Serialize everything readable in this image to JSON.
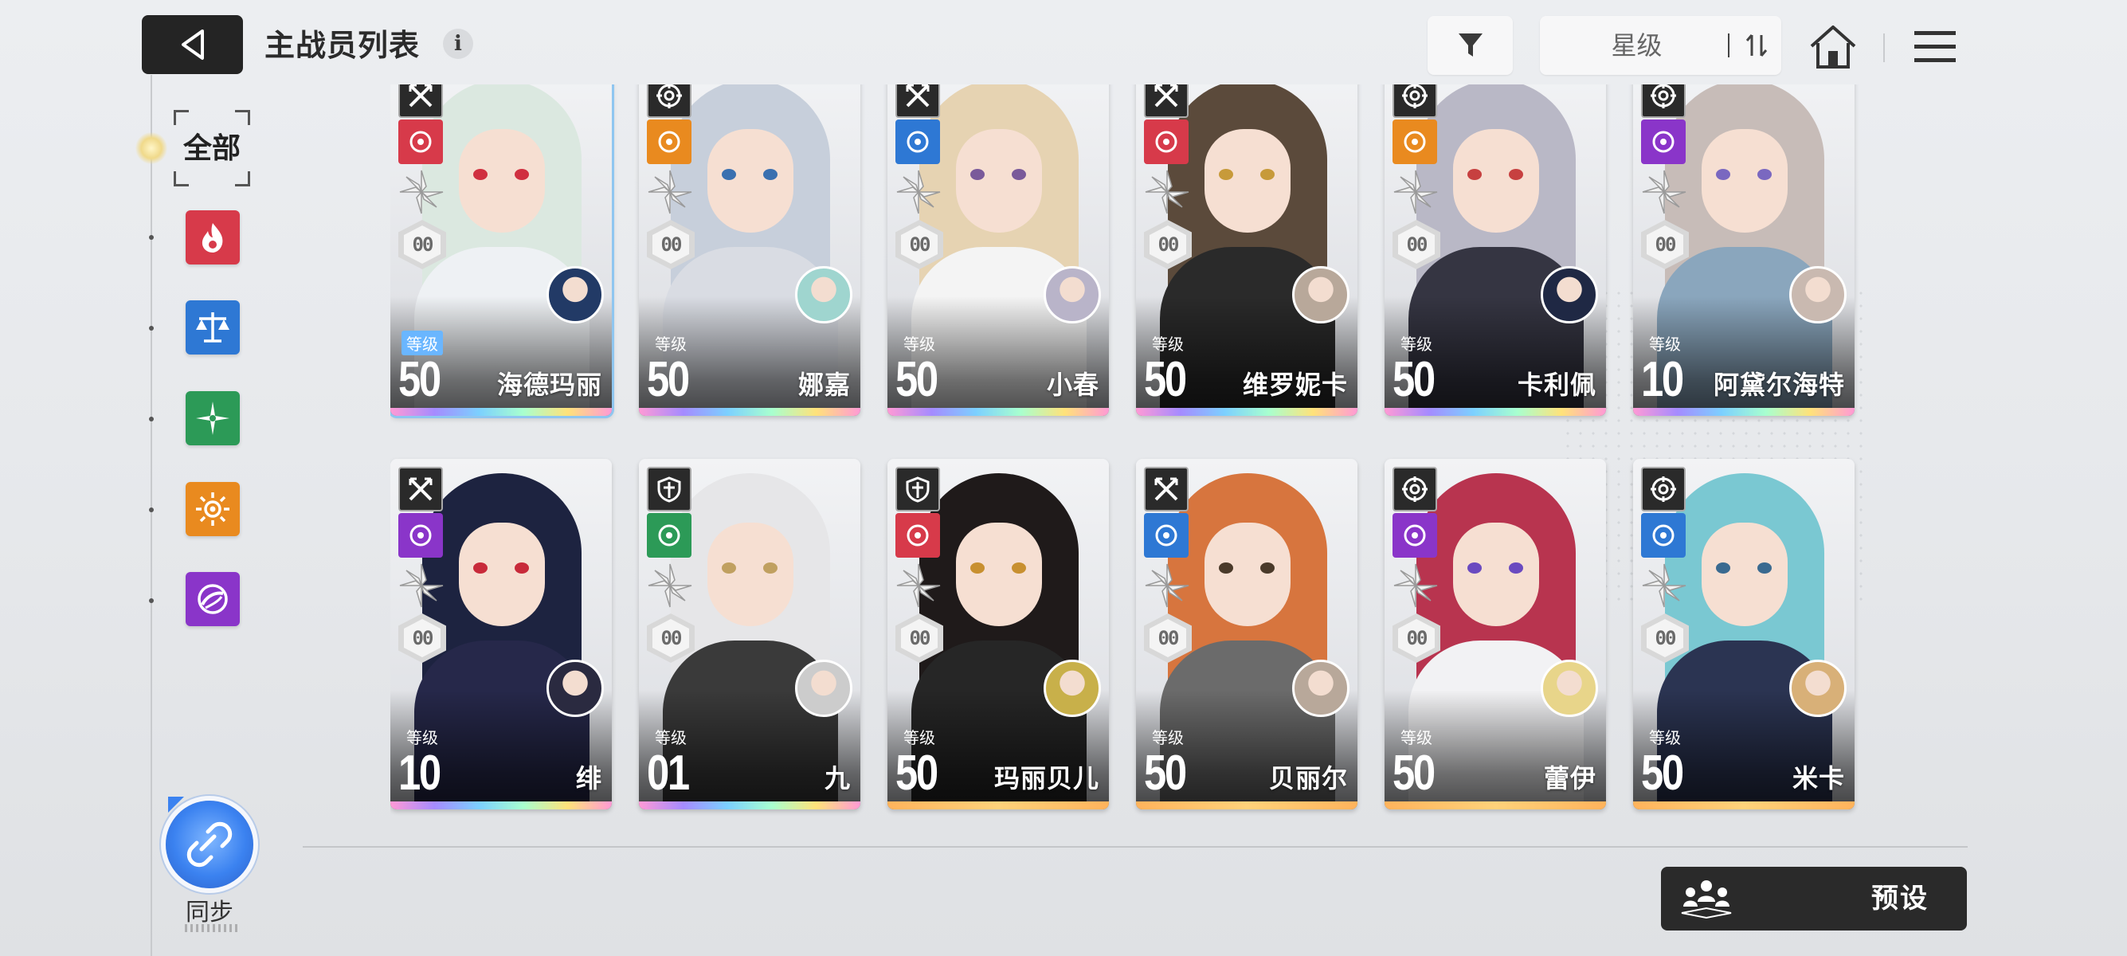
{
  "header": {
    "title": "主战员列表",
    "info_label": "i",
    "sort_label": "星级"
  },
  "sidebar": {
    "all_label": "全部",
    "categories": [
      {
        "name": "burn",
        "color": "#d73a4a"
      },
      {
        "name": "balance",
        "color": "#2e78d4"
      },
      {
        "name": "wind",
        "color": "#2c9a57"
      },
      {
        "name": "radiance",
        "color": "#e98a1f"
      },
      {
        "name": "void",
        "color": "#8a35c9"
      }
    ],
    "sync_label": "同步"
  },
  "level_label": "等级",
  "cards": [
    {
      "name": "海德玛丽",
      "level": "50",
      "element": "#d73a4a",
      "hair": "#dbe8e0",
      "body": "#eef1f4",
      "eye": "#d03040",
      "avatar_bg": "#223a66",
      "selected": true,
      "rarity": "rainbow",
      "class_icon": "sword"
    },
    {
      "name": "娜嘉",
      "level": "50",
      "element": "#e98a1f",
      "hair": "#c7cfdb",
      "body": "#d9dce3",
      "eye": "#3a70b0",
      "avatar_bg": "#9fd5cf",
      "selected": false,
      "rarity": "rainbow",
      "class_icon": "target"
    },
    {
      "name": "小春",
      "level": "50",
      "element": "#2e78d4",
      "hair": "#e6d3b2",
      "body": "#f4f4f4",
      "eye": "#7a5a9a",
      "avatar_bg": "#b9b4c9",
      "selected": false,
      "rarity": "rainbow",
      "class_icon": "sword"
    },
    {
      "name": "维罗妮卡",
      "level": "50",
      "element": "#d73a4a",
      "hair": "#5b4a3b",
      "body": "#2a2a2a",
      "eye": "#c79a3a",
      "avatar_bg": "#b8a89a",
      "selected": false,
      "rarity": "rainbow",
      "class_icon": "sword"
    },
    {
      "name": "卡利佩",
      "level": "50",
      "element": "#e98a1f",
      "hair": "#b9b8c6",
      "body": "#353542",
      "eye": "#c74040",
      "avatar_bg": "#1f2844",
      "selected": false,
      "rarity": "rainbow",
      "class_icon": "target"
    },
    {
      "name": "阿黛尔海特",
      "level": "10",
      "element": "#8a35c9",
      "hair": "#c7bcb8",
      "body": "#8aa6bd",
      "eye": "#7a68c0",
      "avatar_bg": "#c9b9b0",
      "selected": false,
      "rarity": "rainbow",
      "class_icon": "target"
    },
    {
      "name": "绯",
      "level": "10",
      "element": "#8a35c9",
      "hair": "#1d2340",
      "body": "#26284a",
      "eye": "#c82a3a",
      "avatar_bg": "#2a2a40",
      "selected": false,
      "rarity": "rainbow",
      "class_icon": "sword"
    },
    {
      "name": "九",
      "level": "01",
      "element": "#2c9a57",
      "hair": "#e6e6e8",
      "body": "#3a3a3a",
      "eye": "#c0a060",
      "avatar_bg": "#cccccc",
      "selected": false,
      "rarity": "rainbow",
      "class_icon": "shield"
    },
    {
      "name": "玛丽贝儿",
      "level": "50",
      "element": "#d73a4a",
      "hair": "#1f1a1a",
      "body": "#262626",
      "eye": "#c89030",
      "avatar_bg": "#c8b04a",
      "selected": false,
      "rarity": "gold",
      "class_icon": "shield"
    },
    {
      "name": "贝丽尔",
      "level": "50",
      "element": "#2e78d4",
      "hair": "#d7753e",
      "body": "#6b6b6b",
      "eye": "#4a3a2a",
      "avatar_bg": "#b8a89a",
      "selected": false,
      "rarity": "gold",
      "class_icon": "sword"
    },
    {
      "name": "蕾伊",
      "level": "50",
      "element": "#8a35c9",
      "hair": "#b8344f",
      "body": "#f2f2f4",
      "eye": "#6a4ac0",
      "avatar_bg": "#e8d58a",
      "selected": false,
      "rarity": "gold",
      "class_icon": "target"
    },
    {
      "name": "米卡",
      "level": "50",
      "element": "#2e78d4",
      "hair": "#7ac8d2",
      "body": "#2b3452",
      "eye": "#3a6a90",
      "avatar_bg": "#d8b078",
      "selected": false,
      "rarity": "gold",
      "class_icon": "target"
    }
  ],
  "footer": {
    "preset_label": "预设"
  }
}
